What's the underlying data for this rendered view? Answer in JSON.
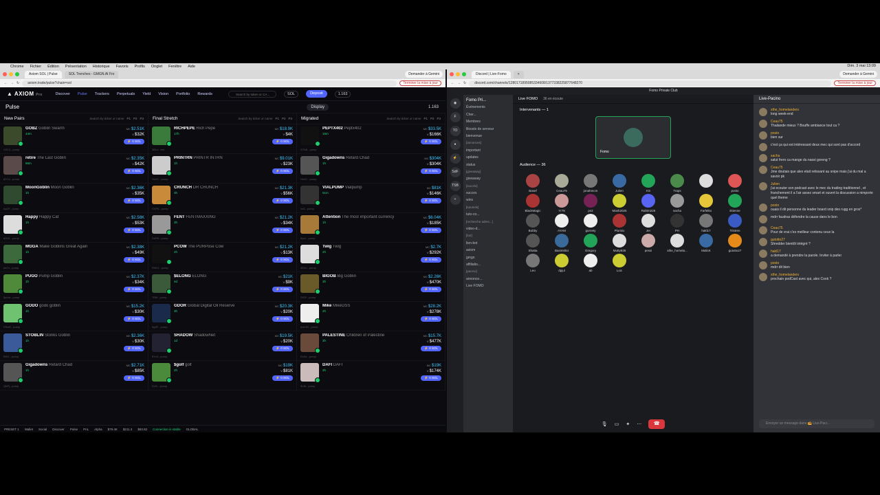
{
  "mac": {
    "menu": [
      "Chrome",
      "Fichier",
      "Édition",
      "Présentation",
      "Historique",
      "Favoris",
      "Profils",
      "Onglet",
      "Fenêtre",
      "Aide"
    ],
    "clock": "Dim. 3 mai 13:09"
  },
  "left": {
    "tabs": [
      "Axiom SOL | Pulse",
      "SOL Trenches - GMGN.AI Fro"
    ],
    "tab_right": "Demander à Gemini",
    "url": "axiom.trade/pulse?chain=sol",
    "update": "Terminer la mise à jour",
    "nav": [
      "Discover",
      "Pulse",
      "Trackers",
      "Perpetuals",
      "Yield",
      "Vision",
      "Portfolio",
      "Rewards"
    ],
    "search_ph": "Search by token or CA...",
    "chain": "SOL",
    "deposit": "Deposit",
    "bal": "1.163",
    "title": "Pulse",
    "display": "Display",
    "count": "1.163",
    "cols": [
      {
        "name": "New Pairs",
        "rows": [
          {
            "t": "GOBZ",
            "n": "Goblin Swarm",
            "age": "44m",
            "mc": "$2.51K",
            "v": "$32K",
            "addr": "X5C3...pump",
            "c": "#3a4a2a"
          },
          {
            "t": "retire",
            "n": "The Last Goblin",
            "age": "56m",
            "mc": "$2.35K",
            "v": "$42K",
            "addr": "8XY4...pump",
            "c": "#5a4a4a"
          },
          {
            "t": "MoonGoblin",
            "n": "Moon Goblin",
            "age": "1h",
            "mc": "$2.36K",
            "v": "$35K",
            "addr": "Ap2F...pump",
            "c": "#2f4a2f"
          },
          {
            "t": "Happy",
            "n": "Happy Cat",
            "age": "1h",
            "mc": "$2.58K",
            "v": "$53K",
            "addr": "8ZnX...pump",
            "c": "#ddd"
          },
          {
            "t": "MGGA",
            "n": "Make Goblins Great Again",
            "age": "1h",
            "mc": "$2.38K",
            "v": "$49K",
            "addr": "da7n...pump",
            "c": "#3d6a3d"
          },
          {
            "t": "PUGO",
            "n": "Pump Goblin",
            "age": "1h",
            "mc": "$2.37K",
            "v": "$34K",
            "addr": "5pUw...pump",
            "c": "#4e8a3a"
          },
          {
            "t": "GODO",
            "n": "godo goblin",
            "age": "1h",
            "mc": "$15.2K",
            "v": "$30K",
            "addr": "F8mR...pump",
            "c": "#6fc26f"
          },
          {
            "t": "STOBLIN",
            "n": "Stonks Goblin",
            "age": "1h",
            "mc": "$2.36K",
            "v": "$30K",
            "addr": "BW1...pump",
            "c": "#3a5a9a"
          },
          {
            "t": "Gigadowns",
            "n": "Retard Chad",
            "age": "1h",
            "mc": "$2.71K",
            "v": "$85K",
            "addr": "QbPj...pump",
            "c": "#555"
          }
        ]
      },
      {
        "name": "Final Stretch",
        "rows": [
          {
            "t": "RICHPEPE",
            "n": "Rich Pepe",
            "age": "17h",
            "mc": "$18.9K",
            "v": "$4K",
            "addr": "3BLo...bnt",
            "c": "#3a7a3a"
          },
          {
            "t": "PRINTRN",
            "n": "PRINTR INTRN",
            "age": "1h",
            "mc": "$9.01K",
            "v": "$23K",
            "addr": "Hu2C...pump",
            "c": "#ccc"
          },
          {
            "t": "CRUNCH",
            "n": "DR CRUNCH",
            "age": "3h",
            "mc": "$21.3K",
            "v": "$56K",
            "addr": "SVPA...pump",
            "c": "#c98a3a"
          },
          {
            "t": "FENT",
            "n": "FENTMAXXING",
            "age": "3h",
            "mc": "$21.2K",
            "v": "$34K",
            "addr": "DeR9...pump",
            "c": "#999"
          },
          {
            "t": "PCOW",
            "n": "The PURPose Cow",
            "age": "2h",
            "mc": "$21.2K",
            "v": "$13K",
            "addr": "PAKX...pump",
            "c": "#111"
          },
          {
            "t": "$ELONG",
            "n": "ELONG",
            "age": "4d",
            "mc": "$21K",
            "v": "$9K",
            "addr": "7BM...pump",
            "c": "#3a5a3a"
          },
          {
            "t": "GDOR",
            "n": "Global Digital Oil Reserve",
            "age": "3h",
            "mc": "$20.3K",
            "v": "$20K",
            "addr": "9gSF...pump",
            "c": "#1a2a4a"
          },
          {
            "t": "SHADOW",
            "n": "ShadowNet",
            "age": "1d",
            "mc": "$19.5K",
            "v": "$20K",
            "addr": "8Yo3...pump",
            "c": "#223"
          },
          {
            "t": "$golf",
            "n": "golf",
            "age": "2h",
            "mc": "$19K",
            "v": "$81K",
            "addr": "2x3L...pump",
            "c": "#4a8a3a"
          }
        ]
      },
      {
        "name": "Migrated",
        "rows": [
          {
            "t": "PEPTX402",
            "n": "Peptx402",
            "age": "15m",
            "mc": "$33.5K",
            "v": "$166K",
            "addr": "G7bB...pump",
            "c": "#111"
          },
          {
            "t": "Gigadowns",
            "n": "Retard Chad",
            "age": "1h",
            "mc": "$304K",
            "v": "$304K",
            "addr": "Hn2C...pump",
            "c": "#555"
          },
          {
            "t": "VIALPUMP",
            "n": "Vialpump",
            "age": "51m",
            "mc": "$81K",
            "v": "$146K",
            "addr": "4x3...pump",
            "c": "#333"
          },
          {
            "t": "Attention",
            "n": "The most important currency",
            "age": "1h",
            "mc": "$6.04K",
            "v": "$185K",
            "addr": "6ysx...pump",
            "c": "#a87a3a"
          },
          {
            "t": "Twig",
            "n": "Twig",
            "age": "2h",
            "mc": "$2.7K",
            "v": "$292K",
            "addr": "4Dnn...pump",
            "c": "#ddd"
          },
          {
            "t": "BIGOB",
            "n": "Big Goblin",
            "age": "3h",
            "mc": "$2.26K",
            "v": "$470K",
            "addr": "SIGF...pump",
            "c": "#6a5a2a"
          },
          {
            "t": "Mike",
            "n": "MikeOSS",
            "age": "2h",
            "mc": "$28.2K",
            "v": "$278K",
            "addr": "Amr1K...pump",
            "c": "#eee"
          },
          {
            "t": "PALESTINE",
            "n": "Children of Palestine",
            "age": "3h",
            "mc": "$15.7K",
            "v": "$477K",
            "addr": "EzNz...pump",
            "c": "#6a4a3a"
          },
          {
            "t": "DAFI",
            "n": "DAFI",
            "age": "3h",
            "mc": "$19K",
            "v": "$174K",
            "addr": "9LBi...pump",
            "c": "#cbb"
          }
        ]
      }
    ],
    "footer": [
      "PRESET 1",
      "Wallet",
      "Social",
      "Discover",
      "Pulse",
      "PnL",
      "Alpha",
      "$79.4K",
      "$211.3",
      "$83.82",
      "Connection is stable",
      "GLOBAL"
    ]
  },
  "right": {
    "tabs": [
      "Discord | Live-Fomo",
      "+"
    ],
    "tab_right": "Demander à Gemini",
    "url": "discord.com/channels/1280171895085334608/1377338225877648270",
    "update": "Terminer la mise à jour",
    "top": "Fomo Private Club",
    "server": "Fomo Pri...",
    "live": "Live FOMO",
    "listeners": "36 en écoute",
    "channels": [
      "Événements",
      "Cher...",
      "Membres",
      "Boosts de serveur",
      "bienvenue",
      "[annonces]",
      "important",
      "updates",
      "status",
      "[giveaway]",
      "giveaway",
      "[succès]",
      "succes",
      "wins",
      "[tutoriels]",
      "tuto-co...",
      "[recherche adres...]",
      "video-d...",
      "[bot]",
      "lien-bot",
      "axiom",
      "gmgn",
      "affiliatio...",
      "[pacino]",
      "annonce...",
      "Live FOMO"
    ],
    "speakers": "Intervenants — 1",
    "speaker_name": "Fomo",
    "audience": "Audience — 36",
    "aud": [
      [
        "Basef",
        "#a44"
      ],
      [
        "Ceau75",
        "#aa9"
      ],
      [
        "jonahmcm",
        "#777"
      ],
      [
        "Julien",
        "#3a6aa4"
      ],
      [
        "KS",
        "#23a559"
      ],
      [
        "Traps",
        "#4a8a4a"
      ],
      [
        "",
        "#ddd"
      ],
      [
        "posto",
        "#d55"
      ],
      [
        "BlackMagic",
        "#a33"
      ],
      [
        "Yr78",
        "#c99"
      ],
      [
        "ps2",
        "#725"
      ],
      [
        "Mash2025",
        "#cc3"
      ],
      [
        "Rahim225",
        "#5865f2"
      ],
      [
        "sacha",
        "#999"
      ],
      [
        "Farfelito",
        "#e6c73a"
      ],
      [
        "Etienne",
        "#23a559"
      ],
      [
        "Bobby",
        "#555"
      ],
      [
        "AYAM",
        "#eee"
      ],
      [
        "gurnety",
        "#eee"
      ],
      [
        "Plurinix",
        "#a33"
      ],
      [
        "Jer",
        "#ddd"
      ],
      [
        "PH",
        "#333"
      ],
      [
        "hakl17",
        "#777"
      ],
      [
        "Tristren",
        "#3a5ac4"
      ],
      [
        "Shatta",
        "#555"
      ],
      [
        "Basim054",
        "#3a6a9a"
      ],
      [
        "Gregory",
        "#23a559"
      ],
      [
        "Mutty936",
        "#ddd"
      ],
      [
        "pessi",
        "#caa"
      ],
      [
        "xthe_homela...",
        "#ddd"
      ],
      [
        "MalicK",
        "#3a6aa4"
      ],
      [
        "gutotto27",
        "#e68a1a"
      ],
      [
        "Leo",
        "#777"
      ],
      [
        "dpjul",
        "#cc3"
      ],
      [
        "ab",
        "#eee"
      ],
      [
        "Loic",
        "#cc3"
      ]
    ],
    "vc": "Voix connectée",
    "vc_sub": "Live-Pacin...",
    "video": "Vidéo",
    "screen": "Écran",
    "chat_title": "Live-Pacino",
    "msgs": [
      [
        "xthe_homelanderx",
        "long week-end"
      ],
      [
        "Ceau75",
        "Thailande mieux ? Bouffe ambiance tout ca ?"
      ],
      [
        "posto",
        "bien sur"
      ],
      [
        "",
        "c'est ça qui est intéressant deux mec qui sont pas d'accord"
      ],
      [
        "sacha",
        "salut frero ca mange du nassi goreng ?"
      ],
      [
        "Ceau75",
        "Jme doutais que alex etait retissant au snipe mais j'ai du mal a savoir pk"
      ],
      [
        "Julien",
        "j'ai ecouter son podcast avec le mec du trading traditionnel , et franchement il a l'air assez smart et ouvert la discussion a nimporte quel theme"
      ],
      [
        "posto",
        "ouais il dit personne du leader board snip des rugg en gros*"
      ],
      [
        "",
        "mdrr faudras défendre la cause  dans le bon"
      ],
      [
        "Ceau75",
        "Pour de vrai c'es meilleur contenu ceux la"
      ],
      [
        "gutotto27",
        "Shredder bientôt intégré ?"
      ],
      [
        "hakl17",
        "a demandé à prendre la parole.  Inviter à parler"
      ],
      [
        "posto",
        "mdrr dit bien"
      ],
      [
        "xthe_homelanderx",
        "prochain podCast avec qui, alex Cook ?"
      ]
    ],
    "chat_ph": "Envoyer un message dans 📻 Live-Paci..."
  }
}
